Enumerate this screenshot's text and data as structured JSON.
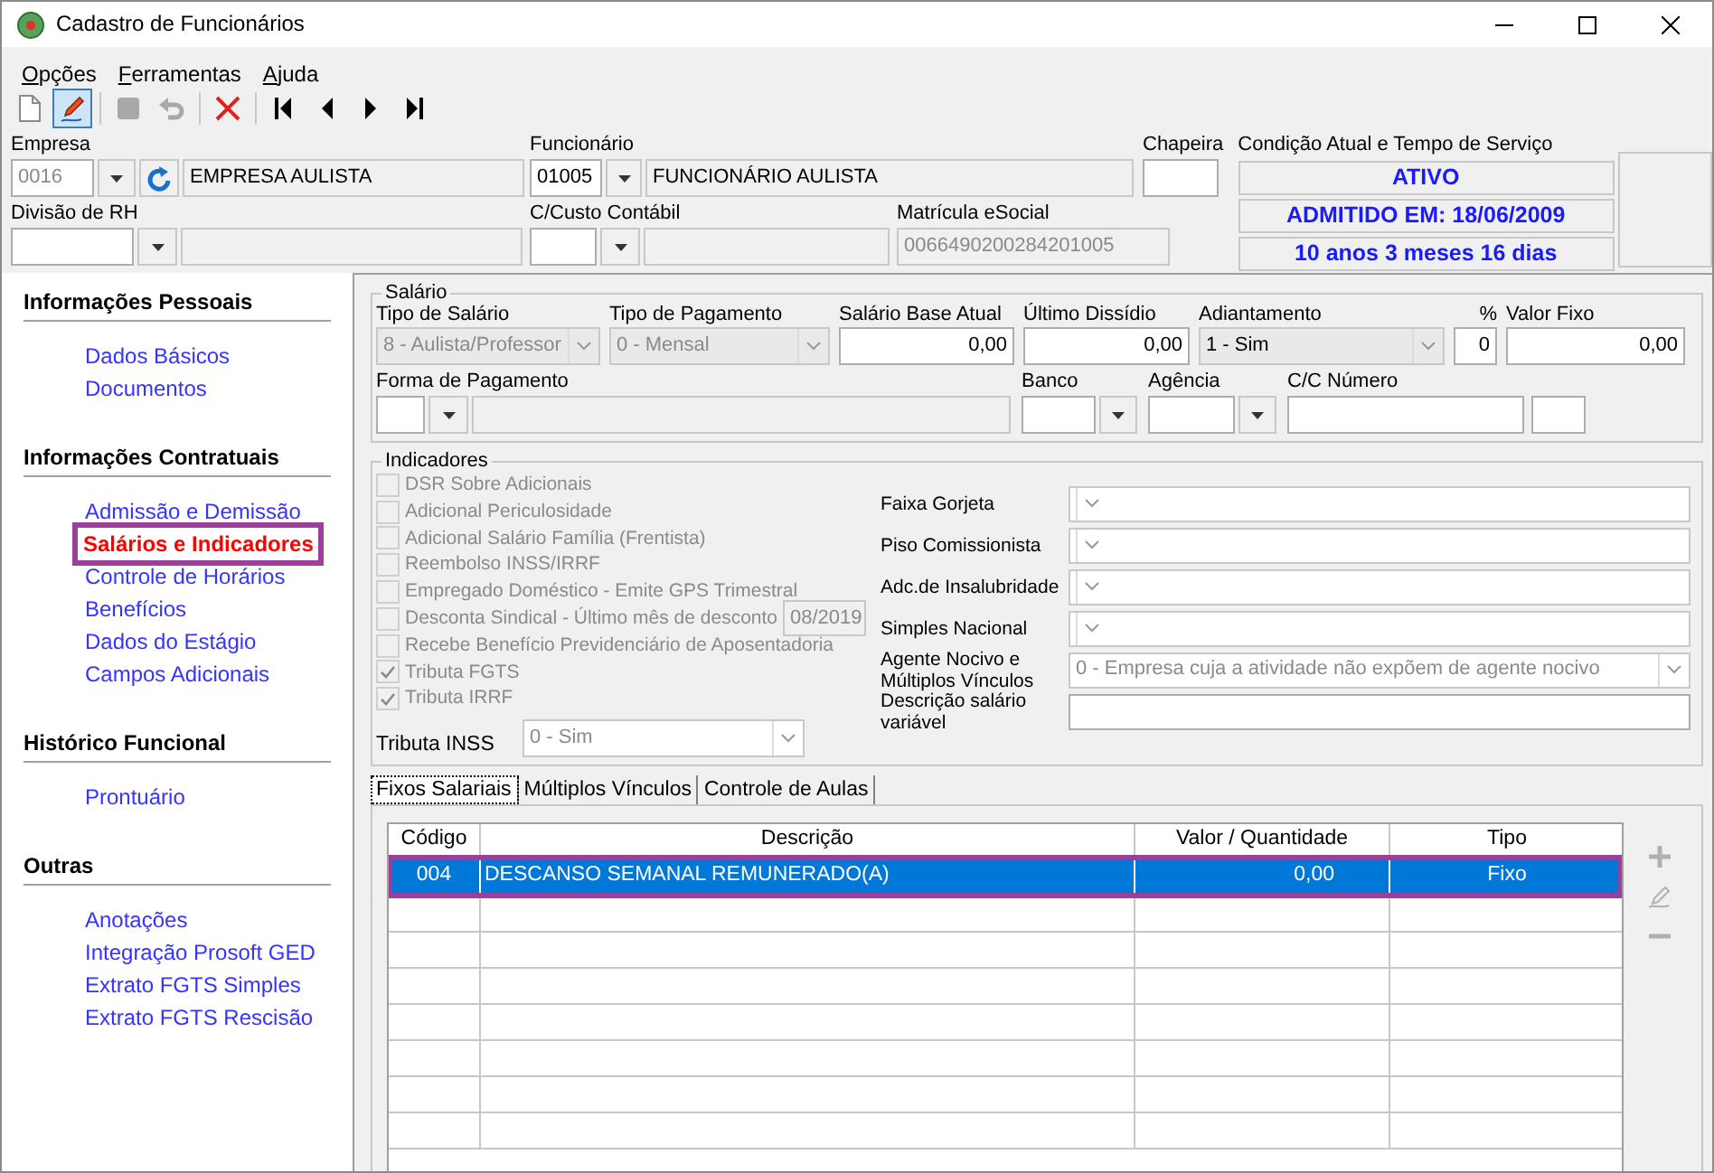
{
  "window": {
    "title": "Cadastro de Funcionários"
  },
  "menu": [
    {
      "label": "Opções"
    },
    {
      "label": "Ferramentas"
    },
    {
      "label": "Ajuda"
    }
  ],
  "toolbar": [
    {
      "kind": "new",
      "disabled": false,
      "selected": false
    },
    {
      "kind": "edit",
      "disabled": false,
      "selected": true
    },
    {
      "kind": "save",
      "disabled": true,
      "selected": false
    },
    {
      "kind": "undo",
      "disabled": true,
      "selected": false
    },
    {
      "kind": "delete",
      "disabled": false,
      "selected": false
    },
    {
      "kind": "first",
      "disabled": false,
      "selected": false
    },
    {
      "kind": "previous",
      "disabled": false,
      "selected": false
    },
    {
      "kind": "next",
      "disabled": false,
      "selected": false
    },
    {
      "kind": "last",
      "disabled": false,
      "selected": false
    }
  ],
  "header": {
    "empresa": {
      "label": "Empresa",
      "code": "0016",
      "name": "EMPRESA AULISTA"
    },
    "funcionario": {
      "label": "Funcionário",
      "code": "01005",
      "name": "FUNCIONÁRIO AULISTA"
    },
    "chapeira": {
      "label": "Chapeira"
    },
    "divisao": {
      "label": "Divisão de RH"
    },
    "custo": {
      "label": "C/Custo Contábil"
    },
    "matricula": {
      "label": "Matrícula eSocial",
      "value": "0066490200284201005"
    },
    "status": {
      "label": "Condição Atual e Tempo de Serviço",
      "lines": [
        "ATIVO",
        "ADMITIDO EM: 18/06/2009",
        "10 anos 3 meses 16 dias"
      ]
    }
  },
  "sidebar": {
    "sections": [
      {
        "title": "Informações Pessoais",
        "items": [
          {
            "label": "Dados Básicos",
            "selected": false,
            "highlighted": false
          },
          {
            "label": "Documentos",
            "selected": false,
            "highlighted": false
          }
        ]
      },
      {
        "title": "Informações Contratuais",
        "items": [
          {
            "label": "Admissão e Demissão",
            "selected": false,
            "highlighted": false
          },
          {
            "label": "Salários e Indicadores",
            "selected": true,
            "highlighted": true
          },
          {
            "label": "Controle de Horários",
            "selected": false,
            "highlighted": false
          },
          {
            "label": "Benefícios",
            "selected": false,
            "highlighted": false
          },
          {
            "label": "Dados do Estágio",
            "selected": false,
            "highlighted": false
          },
          {
            "label": "Campos Adicionais",
            "selected": false,
            "highlighted": false
          }
        ]
      },
      {
        "title": "Histórico Funcional",
        "items": [
          {
            "label": "Prontuário",
            "selected": false,
            "highlighted": false
          }
        ]
      },
      {
        "title": "Outras",
        "items": [
          {
            "label": "Anotações",
            "selected": false,
            "highlighted": false
          },
          {
            "label": "Integração Prosoft GED",
            "selected": false,
            "highlighted": false
          },
          {
            "label": "Extrato FGTS Simples",
            "selected": false,
            "highlighted": false
          },
          {
            "label": "Extrato FGTS Rescisão",
            "selected": false,
            "highlighted": false
          }
        ]
      }
    ]
  },
  "salario": {
    "title": "Salário",
    "top_fields": [
      {
        "kind": "combo",
        "label": "Tipo de Salário",
        "value": "8 - Aulista/Professor",
        "disabled": true
      },
      {
        "kind": "combo",
        "label": "Tipo de Pagamento",
        "value": "0 - Mensal",
        "disabled": true
      },
      {
        "kind": "number",
        "label": "Salário Base Atual",
        "value": "0,00"
      },
      {
        "kind": "number",
        "label": "Último Dissídio",
        "value": "0,00"
      },
      {
        "kind": "combo",
        "label": "Adiantamento",
        "value": "1 - Sim",
        "disabled": false
      },
      {
        "kind": "number",
        "label": "%",
        "value": "0"
      },
      {
        "kind": "number",
        "label": "Valor Fixo",
        "value": "0,00"
      }
    ],
    "bottom_fields": [
      {
        "kind": "lookup",
        "label": "Forma de Pagamento"
      },
      {
        "kind": "picker",
        "label": "Banco"
      },
      {
        "kind": "picker",
        "label": "Agência"
      },
      {
        "kind": "account",
        "label": "C/C Número"
      }
    ]
  },
  "indicadores": {
    "title": "Indicadores",
    "checks": [
      {
        "label": "DSR Sobre Adicionais",
        "checked": false,
        "disabled": true
      },
      {
        "label": "Adicional Periculosidade",
        "checked": false,
        "disabled": true
      },
      {
        "label": "Adicional Salário Família (Frentista)",
        "checked": false,
        "disabled": true
      },
      {
        "label": "Reembolso INSS/IRRF",
        "checked": false,
        "disabled": true
      },
      {
        "label": "Empregado Doméstico - Emite GPS Trimestral",
        "checked": false,
        "disabled": true
      },
      {
        "label": "Desconta Sindical - Último mês de desconto",
        "checked": false,
        "disabled": true,
        "value": "08/2019"
      },
      {
        "label": "Recebe Benefício Previdenciário de Aposentadoria",
        "checked": false,
        "disabled": true
      },
      {
        "label": "Tributa FGTS",
        "checked": true,
        "disabled": true
      },
      {
        "label": "Tributa IRRF",
        "checked": true,
        "disabled": true
      }
    ],
    "tributa_inss": {
      "label": "Tributa INSS",
      "value": "0 - Sim",
      "disabled": true
    },
    "fields": [
      {
        "kind": "combo",
        "label": "Faixa Gorjeta"
      },
      {
        "kind": "combo",
        "label": "Piso Comissionista"
      },
      {
        "kind": "combo",
        "label": "Adc.de Insalubridade"
      },
      {
        "kind": "combo",
        "label": "Simples Nacional"
      },
      {
        "kind": "combo",
        "label": "Agente Nocivo e Múltiplos Vínculos",
        "value": "0 - Empresa cuja a atividade não expõem de agente nocivo"
      },
      {
        "kind": "text",
        "label": "Descrição salário variável"
      }
    ]
  },
  "tabs": [
    {
      "label": "Fixos Salariais",
      "selected": true
    },
    {
      "label": "Múltiplos Vínculos",
      "selected": false
    },
    {
      "label": "Controle de Aulas",
      "selected": false
    }
  ],
  "table": {
    "columns": [
      "Código",
      "Descrição",
      "Valor / Quantidade",
      "Tipo"
    ],
    "rows": [
      {
        "cells": [
          "004",
          "DESCANSO SEMANAL REMUNERADO(A)",
          "0,00",
          "Fixo"
        ],
        "selected": true,
        "highlighted": true
      }
    ],
    "actions": [
      {
        "kind": "add",
        "disabled": true
      },
      {
        "kind": "edit",
        "disabled": true
      },
      {
        "kind": "remove",
        "disabled": true
      }
    ]
  }
}
